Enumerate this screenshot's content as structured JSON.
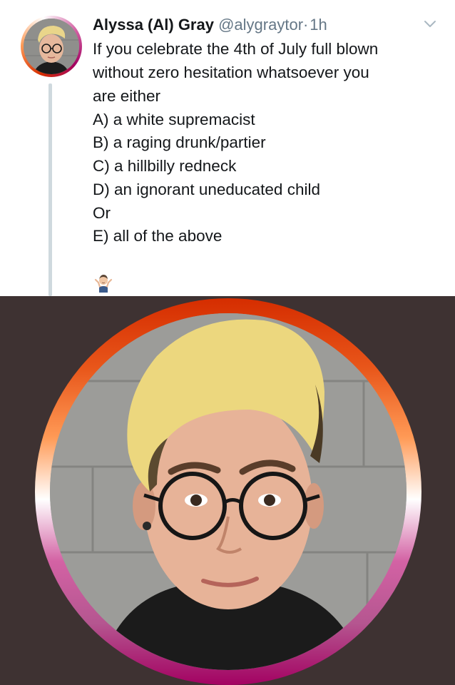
{
  "tweet": {
    "author_name": "Alyssa (Al) Gray",
    "handle": "@alygraytor",
    "separator": "·",
    "time": "1h",
    "lines": [
      "If you celebrate the 4th of July full blown",
      "without zero hesitation whatsoever you",
      "are either",
      "A) a white supremacist",
      "B) a raging drunk/partier",
      "C) a hillbilly redneck",
      "D) an ignorant uneducated child",
      "Or",
      "E) all of the above"
    ],
    "emoji_icon": "person-shrugging-emoji",
    "menu_icon": "chevron-down-icon"
  },
  "colors": {
    "text": "#14171a",
    "muted": "#657786",
    "thread_line": "#cfd9de",
    "profile_background": "#3e3232",
    "ring_gradient": [
      "#d52d00",
      "#ff9a56",
      "#ffffff",
      "#d362a4",
      "#a30262"
    ]
  }
}
